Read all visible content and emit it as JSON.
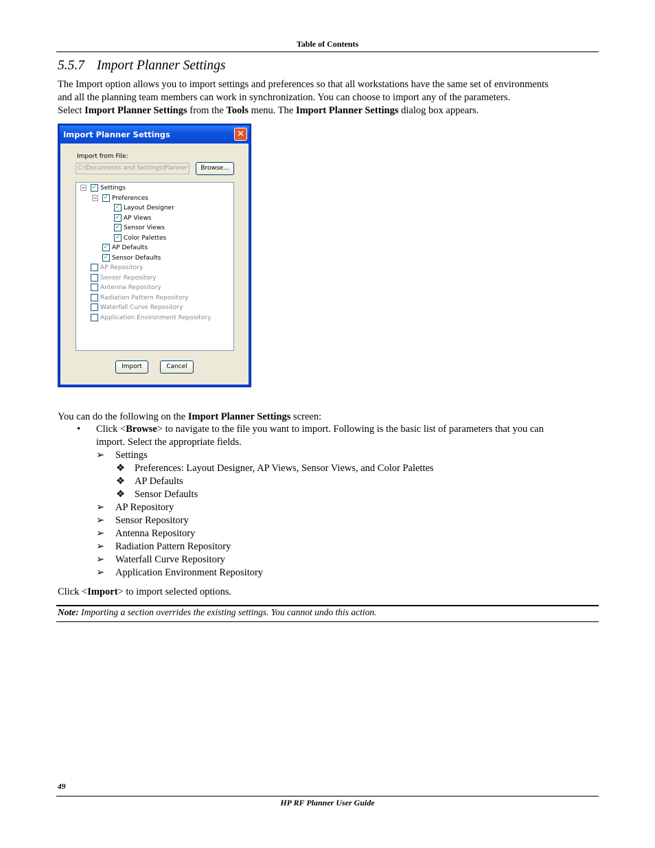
{
  "header": {
    "title": "Table of Contents"
  },
  "section": {
    "number": "5.5.7",
    "title": "Import Planner Settings"
  },
  "intro": {
    "line1": "The Import option allows you to import settings and preferences so that all workstations have the same set of environments",
    "line2": "and all the planning team members can work in synchronization. You can choose to import any of the parameters.",
    "select_pre": "Select ",
    "select_b1": "Import Planner Settings",
    "select_mid1": " from the ",
    "select_b2": "Tools",
    "select_mid2": " menu. The ",
    "select_b3": "Import Planner Settings",
    "select_post": " dialog box appears."
  },
  "dialog": {
    "title": "Import Planner Settings",
    "close": "✕",
    "import_label": "Import from File:",
    "file_path": "C:\\Documents and Settings\\Planner",
    "browse": "Browse...",
    "import_btn": "Import",
    "cancel_btn": "Cancel",
    "tree": [
      {
        "label": "Settings",
        "checked": true,
        "level": 0
      },
      {
        "label": "Preferences",
        "checked": true,
        "level": 1
      },
      {
        "label": "Layout Designer",
        "checked": true,
        "level": 2
      },
      {
        "label": "AP Views",
        "checked": true,
        "level": 2
      },
      {
        "label": "Sensor Views",
        "checked": true,
        "level": 2
      },
      {
        "label": "Color Palettes",
        "checked": true,
        "level": 2
      },
      {
        "label": "AP Defaults",
        "checked": true,
        "level": 1
      },
      {
        "label": "Sensor Defaults",
        "checked": true,
        "level": 1
      },
      {
        "label": "AP Repository",
        "checked": false,
        "level": 0
      },
      {
        "label": "Sensor Repository",
        "checked": false,
        "level": 0
      },
      {
        "label": "Antenna Repository",
        "checked": false,
        "level": 0
      },
      {
        "label": "Radiation Pattern Repository",
        "checked": false,
        "level": 0
      },
      {
        "label": "Waterfall Curve Repository",
        "checked": false,
        "level": 0
      },
      {
        "label": "Application Environment Repository",
        "checked": false,
        "level": 0
      }
    ]
  },
  "body": {
    "lead_pre": "You can do the following on the ",
    "lead_b": "Import Planner Settings",
    "lead_post": " screen:",
    "bullet_pre": "Click <",
    "bullet_b": "Browse",
    "bullet_post": "> to navigate to the file you want to import. Following is the basic list of parameters that you can",
    "bullet_line2": "import. Select the appropriate fields.",
    "items": [
      {
        "label": "Settings",
        "level": 1
      },
      {
        "label": "Preferences: Layout Designer, AP Views, Sensor Views, and Color Palettes",
        "level": 2
      },
      {
        "label": "AP Defaults",
        "level": 2
      },
      {
        "label": "Sensor Defaults",
        "level": 2
      },
      {
        "label": "AP Repository",
        "level": 1
      },
      {
        "label": "Sensor Repository",
        "level": 1
      },
      {
        "label": "Antenna Repository",
        "level": 1
      },
      {
        "label": "Radiation Pattern Repository",
        "level": 1
      },
      {
        "label": "Waterfall Curve Repository",
        "level": 1
      },
      {
        "label": "Application Environment Repository",
        "level": 1
      }
    ],
    "click_pre": "Click <",
    "click_b": "Import",
    "click_post": "> to import selected options."
  },
  "note": {
    "label": "Note:",
    "text": " Importing a section overrides the existing settings. You cannot undo this action."
  },
  "footer": {
    "page": "49",
    "guide": "HP RF Planner User Guide"
  }
}
